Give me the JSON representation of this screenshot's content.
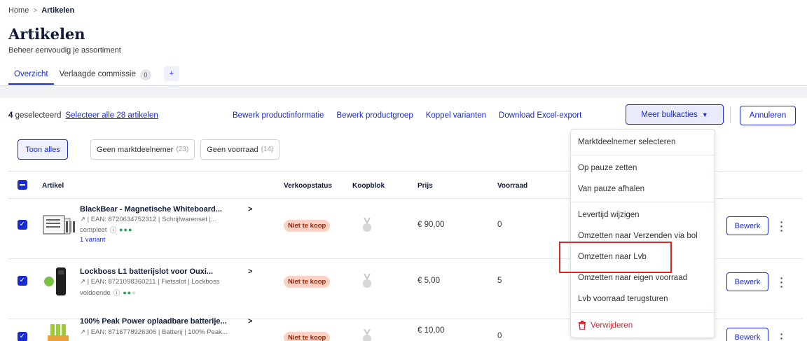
{
  "breadcrumb": {
    "home": "Home",
    "sep": ">",
    "current": "Artikelen"
  },
  "page": {
    "title": "Artikelen",
    "subtitle": "Beheer eenvoudig je assortiment"
  },
  "tabs": [
    {
      "label": "Overzicht",
      "active": true
    },
    {
      "label": "Verlaagde commissie",
      "count": "0"
    }
  ],
  "tab_add": "+",
  "bulkbar": {
    "selected_num": "4",
    "selected_text": "geselecteerd",
    "select_all": "Selecteer alle 28 artikelen",
    "actions": [
      "Bewerk productinformatie",
      "Bewerk productgroep",
      "Koppel varianten",
      "Download Excel-export"
    ],
    "more": "Meer bulkacties",
    "cancel": "Annuleren"
  },
  "filters": [
    {
      "label": "Toon alles",
      "active": true
    },
    {
      "label": "Geen marktdeelnemer",
      "count": "(23)"
    },
    {
      "label": "Geen voorraad",
      "count": "(14)"
    }
  ],
  "table": {
    "headers": [
      "Artikel",
      "Verkoopstatus",
      "Koopblok",
      "Prijs",
      "Voorraad"
    ],
    "rows": [
      {
        "title": "BlackBear - Magnetische Whiteboard...",
        "meta": "| EAN: 8720634752312 | Schrijfwarenset |...",
        "status_word": "compleet",
        "variant": "1 variant",
        "badge": "Niet te koop",
        "price": "€ 90,00",
        "stock": "0",
        "edit": "Bewerk"
      },
      {
        "title": "Lockboss L1 batterijslot voor Ouxi...",
        "meta": "| EAN: 8721098360211 | Fietsslot | Lockboss",
        "status_word": "voldoende",
        "badge": "Niet te koop",
        "price": "€ 5,00",
        "stock": "5",
        "edit": "Bewerk"
      },
      {
        "title": "100% Peak Power oplaadbare batterije...",
        "meta": "| EAN: 8716778926306 | Batterij | 100% Peak...",
        "badge": "Niet te koop",
        "price": "€ 10,00",
        "stock": "0",
        "edit": "Bewerk"
      }
    ]
  },
  "dropdown": {
    "items": [
      "Marktdeelnemer selecteren",
      "Op pauze zetten",
      "Van pauze afhalen",
      "Levertijd wijzigen",
      "Omzetten naar Verzenden via bol",
      "Omzetten naar Lvb",
      "Omzetten naar eigen voorraad",
      "Lvb voorraad terugsturen"
    ],
    "delete": "Verwijderen"
  },
  "colors": {
    "accent": "#1a2bd0",
    "badge_bg": "#fbd2c4",
    "danger": "#d6262a",
    "highlight": "#e02424"
  }
}
